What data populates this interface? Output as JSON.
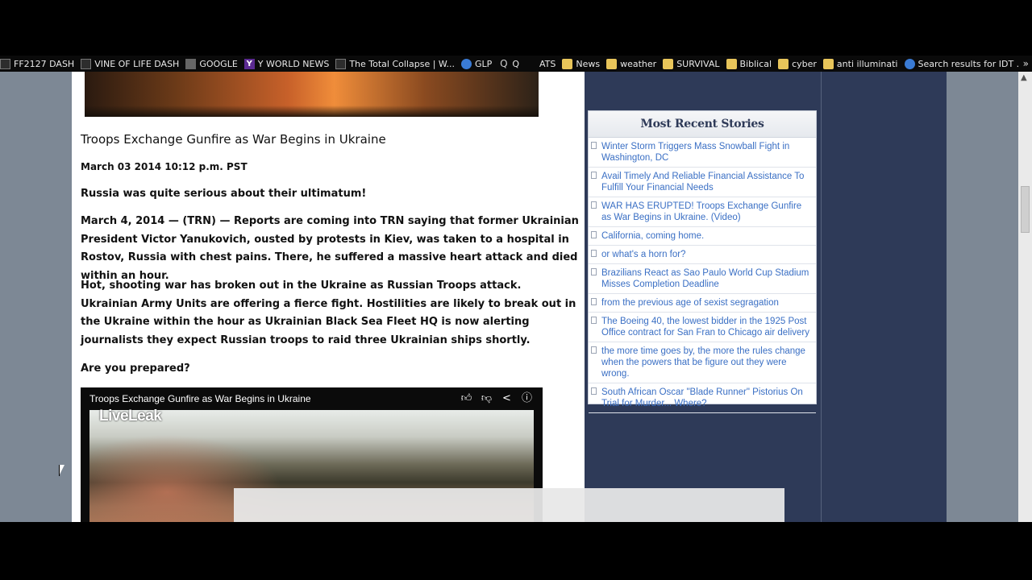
{
  "bookmarks": [
    {
      "label": "FF2127 DASH",
      "icon": "page-icon"
    },
    {
      "label": "VINE OF LIFE DASH",
      "icon": "page-icon"
    },
    {
      "label": "GOOGLE",
      "icon": "google-icon"
    },
    {
      "label": "Y WORLD NEWS",
      "icon": "yahoo-icon"
    },
    {
      "label": "The Total Collapse | W...",
      "icon": "page-icon"
    },
    {
      "label": "GLP",
      "icon": "globe-icon"
    },
    {
      "label": "Q",
      "icon": "q-icon"
    },
    {
      "label": "ATS",
      "icon": "page-icon"
    },
    {
      "label": "News",
      "icon": "folder-icon"
    },
    {
      "label": "weather",
      "icon": "folder-icon"
    },
    {
      "label": "SURVIVAL",
      "icon": "folder-icon"
    },
    {
      "label": "Biblical",
      "icon": "folder-icon"
    },
    {
      "label": "cyber",
      "icon": "folder-icon"
    },
    {
      "label": "anti illuminati",
      "icon": "folder-icon"
    },
    {
      "label": "Search results for IDT ...",
      "icon": "globe-icon"
    }
  ],
  "bookmarks_more": "»",
  "article": {
    "title": "Troops Exchange Gunfire as War Begins in Ukraine",
    "date": "March 03 2014 10:12 p.m. PST",
    "lead": "Russia was quite serious about their ultimatum!",
    "paragraph1": "March 4, 2014 — (TRN) — Reports are coming into TRN saying that former Ukrainian President Victor Yanukovich, ousted by protests in Kiev,  was taken to a hospital in Rostov, Russia with chest pains.  There, he suffered a massive heart attack and died within an hour.",
    "paragraph2": "Hot, shooting war has broken out in the Ukraine as Russian Troops attack. Ukrainian Army Units are offering a fierce fight. Hostilities are likely to break out in the Ukraine within the hour as Ukrainian Black Sea Fleet HQ is now alerting journalists they expect Russian troops to raid three Ukrainian ships shortly.",
    "question": "Are you prepared?"
  },
  "video": {
    "title": "Troops Exchange Gunfire as War Begins in Ukraine",
    "watermark": "LiveLeak",
    "controls": [
      "thumbs-up-icon",
      "thumbs-down-icon",
      "share-icon",
      "info-icon"
    ]
  },
  "sidebar": {
    "widget_title": "Most Recent Stories",
    "stories": [
      "Winter Storm Triggers Mass Snowball Fight in Washington, DC",
      "Avail Timely And Reliable Financial Assistance To Fulfill Your Financial Needs",
      "WAR HAS ERUPTED! Troops Exchange Gunfire as War Begins in Ukraine. (Video)",
      "California, coming home.",
      "or what's a horn for?",
      "Brazilians React as Sao Paulo World Cup Stadium Misses Completion Deadline",
      "from the previous age of sexist segragation",
      "The Boeing 40, the lowest bidder in the 1925 Post Office contract for San Fran to Chicago air delivery",
      "the more time goes by, the more the rules change when the powers that be figure out they were wrong.",
      "South African Oscar \"Blade Runner\" Pistorius On Trial for Murder... Where?"
    ]
  },
  "colors": {
    "sidebar_bg": "#2e3a58",
    "link": "#3a6fc4",
    "page_bg": "#7d8895"
  }
}
